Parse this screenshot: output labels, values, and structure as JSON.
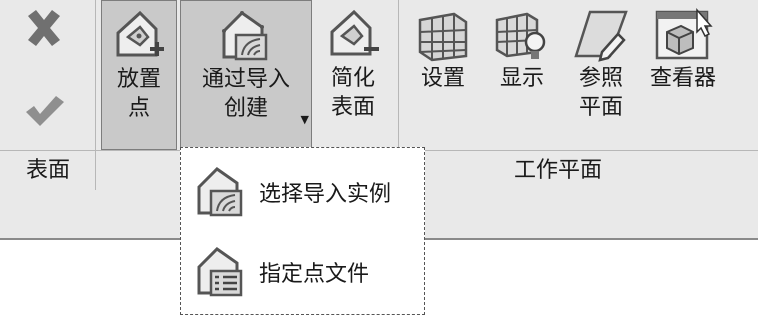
{
  "ribbon": {
    "tools": {
      "cancel": {
        "icon": "close-icon"
      },
      "finish": {
        "icon": "check-icon"
      },
      "place_point": {
        "line1": "放置",
        "line2": "点",
        "icon": "place-point-icon"
      },
      "create_from_import": {
        "line1": "通过导入",
        "line2": "创建",
        "icon": "import-surface-icon"
      },
      "simplify_surface": {
        "line1": "简化",
        "line2": "表面",
        "icon": "simplify-surface-icon"
      },
      "set": {
        "line1": "设置",
        "icon": "grid-plane-icon"
      },
      "show": {
        "line1": "显示",
        "icon": "show-plane-icon"
      },
      "ref_plane": {
        "line1": "参照",
        "line2": "平面",
        "icon": "reference-plane-icon"
      },
      "viewer": {
        "line1": "查看器",
        "icon": "viewer-icon"
      }
    },
    "panels": {
      "surface": "表面",
      "work_plane": "工作平面"
    }
  },
  "dropdown": {
    "items": [
      {
        "label": "选择导入实例",
        "icon": "select-import-instance-icon"
      },
      {
        "label": "指定点文件",
        "icon": "point-file-icon"
      }
    ]
  },
  "colors": {
    "ribbon_bg": "#e9e9e9",
    "pressed_bg": "#c9c9c9",
    "dropdown_bg": "#ffffff",
    "accent_gray": "#7a7a7a"
  }
}
